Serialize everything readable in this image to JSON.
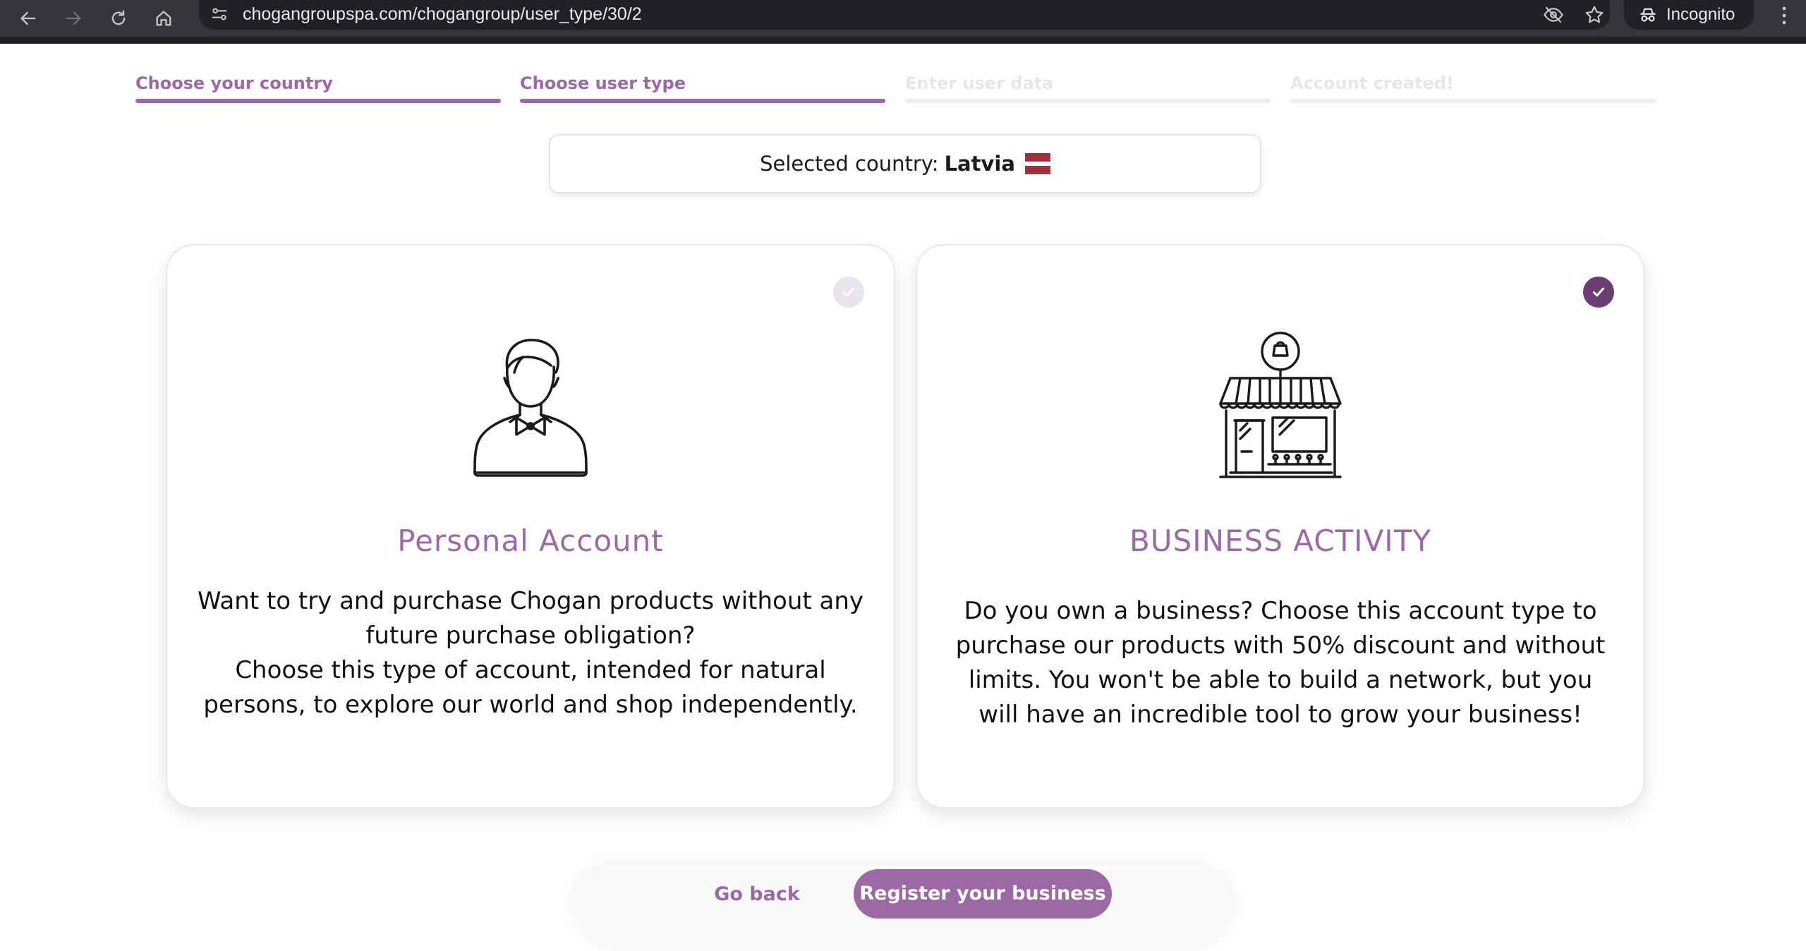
{
  "browser": {
    "url": "chogangroupspa.com/chogangroup/user_type/30/2",
    "incognito_label": "Incognito"
  },
  "steps": [
    {
      "label": "Choose your country",
      "state": "done"
    },
    {
      "label": "Choose user type",
      "state": "done"
    },
    {
      "label": "Enter user data",
      "state": "todo"
    },
    {
      "label": "Account created!",
      "state": "todo"
    }
  ],
  "country": {
    "prefix": "Selected country:",
    "name": "Latvia",
    "flag_colors": [
      "#9e3039",
      "#ffffff",
      "#9e3039"
    ]
  },
  "cards": {
    "personal": {
      "title": "Personal Account",
      "desc_line1": "Want to try and purchase Chogan products without any future purchase obligation?",
      "desc_line2": "Choose this type of account, intended for natural persons, to explore our world and shop independently.",
      "selected": false,
      "icon": "person-bowtie-icon"
    },
    "business": {
      "title": "BUSINESS ACTIVITY",
      "desc": "Do you own a business? Choose this account type to purchase our products with 50% discount and without limits. You won't be able to build a network, but you will have an incredible tool to grow your business!",
      "selected": true,
      "icon": "storefront-icon"
    }
  },
  "actions": {
    "back_label": "Go back",
    "register_label": "Register your business"
  },
  "colors": {
    "accent": "#9b6aa5",
    "check_selected": "#6b3d73",
    "chrome": "#35363a"
  }
}
